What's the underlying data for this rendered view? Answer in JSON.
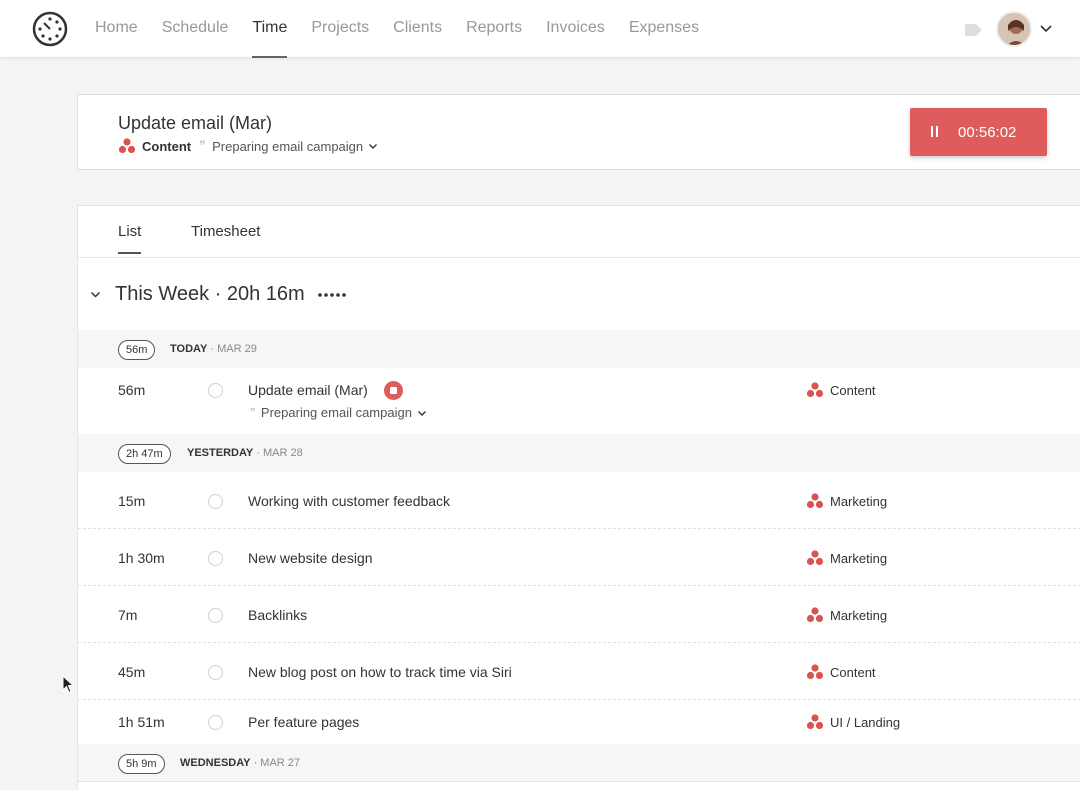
{
  "nav": {
    "items": [
      {
        "label": "Home",
        "active": false
      },
      {
        "label": "Schedule",
        "active": false
      },
      {
        "label": "Time",
        "active": true
      },
      {
        "label": "Projects",
        "active": false
      },
      {
        "label": "Clients",
        "active": false
      },
      {
        "label": "Reports",
        "active": false
      },
      {
        "label": "Invoices",
        "active": false
      },
      {
        "label": "Expenses",
        "active": false
      }
    ],
    "logo_icon": "clock-dots-icon",
    "notification_icon": "bell-icon",
    "avatar_icon": "user-avatar"
  },
  "timer": {
    "title": "Update email (Mar)",
    "project": "Content",
    "task": "Preparing email campaign",
    "elapsed": "00:56:02",
    "button_color": "#e05c5c"
  },
  "tabs": [
    {
      "label": "List",
      "active": true
    },
    {
      "label": "Timesheet",
      "active": false
    }
  ],
  "week": {
    "title": "This Week · 20h 16m"
  },
  "days": [
    {
      "badge": "56m",
      "name": "TODAY",
      "date": "· MAR 29"
    },
    {
      "badge": "2h 47m",
      "name": "YESTERDAY",
      "date": "· MAR 28"
    },
    {
      "badge": "5h 9m",
      "name": "WEDNESDAY",
      "date": "· MAR 27"
    }
  ],
  "entries": [
    {
      "duration": "56m",
      "title": "Update email (Mar)",
      "task": "Preparing email campaign",
      "project": "Content",
      "running": true
    },
    {
      "duration": "15m",
      "title": "Working with customer feedback",
      "project": "Marketing"
    },
    {
      "duration": "1h 30m",
      "title": "New website design",
      "project": "Marketing"
    },
    {
      "duration": "7m",
      "title": "Backlinks",
      "project": "Marketing"
    },
    {
      "duration": "45m",
      "title": "New blog post on how to track time via Siri",
      "project": "Content"
    },
    {
      "duration": "1h 51m",
      "title": "Per feature pages",
      "project": "UI / Landing"
    }
  ],
  "colors": {
    "accent_red": "#e05c5c",
    "project_dots": "#d9534f"
  }
}
